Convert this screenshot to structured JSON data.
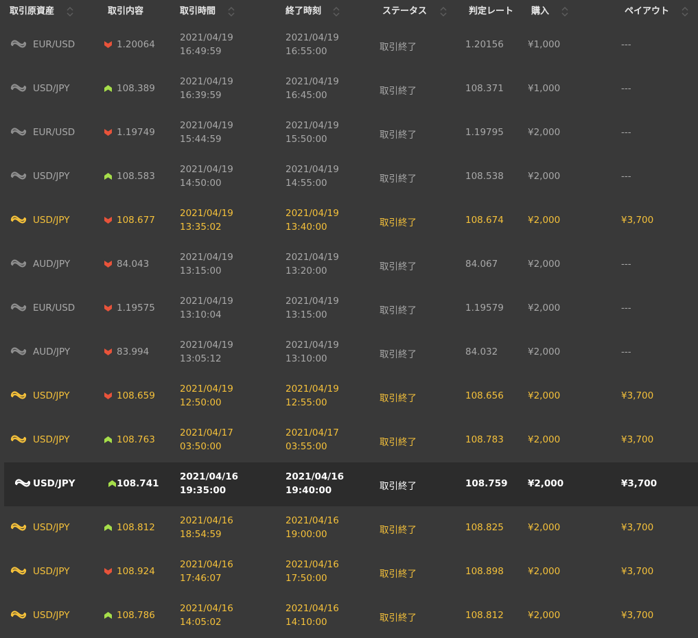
{
  "colors": {
    "background": "#393939",
    "selected_row": "#2c2c2c",
    "win_text": "#f5c13a",
    "loss_text": "#a9a9a9",
    "header_text": "#e9e9e9",
    "high_arrow": "#a6de4a",
    "low_arrow": "#e8533a"
  },
  "header": {
    "asset": "取引原資産",
    "content": "取引内容",
    "start_time": "取引時間",
    "end_time": "終了時刻",
    "status": "ステータス",
    "judge_rate": "判定レート",
    "purchase": "購入",
    "payout": "ペイアウト"
  },
  "rows": [
    {
      "asset": "EUR/USD",
      "direction": "low",
      "entry_rate": "1.20064",
      "start_date": "2021/04/19",
      "start_time": "16:49:59",
      "end_date": "2021/04/19",
      "end_time": "16:55:00",
      "status": "取引終了",
      "judge_rate": "1.20156",
      "purchase": "¥1,000",
      "payout": "---",
      "result": "loss"
    },
    {
      "asset": "USD/JPY",
      "direction": "high",
      "entry_rate": "108.389",
      "start_date": "2021/04/19",
      "start_time": "16:39:59",
      "end_date": "2021/04/19",
      "end_time": "16:45:00",
      "status": "取引終了",
      "judge_rate": "108.371",
      "purchase": "¥1,000",
      "payout": "---",
      "result": "loss"
    },
    {
      "asset": "EUR/USD",
      "direction": "low",
      "entry_rate": "1.19749",
      "start_date": "2021/04/19",
      "start_time": "15:44:59",
      "end_date": "2021/04/19",
      "end_time": "15:50:00",
      "status": "取引終了",
      "judge_rate": "1.19795",
      "purchase": "¥2,000",
      "payout": "---",
      "result": "loss"
    },
    {
      "asset": "USD/JPY",
      "direction": "high",
      "entry_rate": "108.583",
      "start_date": "2021/04/19",
      "start_time": "14:50:00",
      "end_date": "2021/04/19",
      "end_time": "14:55:00",
      "status": "取引終了",
      "judge_rate": "108.538",
      "purchase": "¥2,000",
      "payout": "---",
      "result": "loss"
    },
    {
      "asset": "USD/JPY",
      "direction": "low",
      "entry_rate": "108.677",
      "start_date": "2021/04/19",
      "start_time": "13:35:02",
      "end_date": "2021/04/19",
      "end_time": "13:40:00",
      "status": "取引終了",
      "judge_rate": "108.674",
      "purchase": "¥2,000",
      "payout": "¥3,700",
      "result": "win"
    },
    {
      "asset": "AUD/JPY",
      "direction": "low",
      "entry_rate": "84.043",
      "start_date": "2021/04/19",
      "start_time": "13:15:00",
      "end_date": "2021/04/19",
      "end_time": "13:20:00",
      "status": "取引終了",
      "judge_rate": "84.067",
      "purchase": "¥2,000",
      "payout": "---",
      "result": "loss"
    },
    {
      "asset": "EUR/USD",
      "direction": "low",
      "entry_rate": "1.19575",
      "start_date": "2021/04/19",
      "start_time": "13:10:04",
      "end_date": "2021/04/19",
      "end_time": "13:15:00",
      "status": "取引終了",
      "judge_rate": "1.19579",
      "purchase": "¥2,000",
      "payout": "---",
      "result": "loss"
    },
    {
      "asset": "AUD/JPY",
      "direction": "low",
      "entry_rate": "83.994",
      "start_date": "2021/04/19",
      "start_time": "13:05:12",
      "end_date": "2021/04/19",
      "end_time": "13:10:00",
      "status": "取引終了",
      "judge_rate": "84.032",
      "purchase": "¥2,000",
      "payout": "---",
      "result": "loss"
    },
    {
      "asset": "USD/JPY",
      "direction": "low",
      "entry_rate": "108.659",
      "start_date": "2021/04/19",
      "start_time": "12:50:00",
      "end_date": "2021/04/19",
      "end_time": "12:55:00",
      "status": "取引終了",
      "judge_rate": "108.656",
      "purchase": "¥2,000",
      "payout": "¥3,700",
      "result": "win"
    },
    {
      "asset": "USD/JPY",
      "direction": "high",
      "entry_rate": "108.763",
      "start_date": "2021/04/17",
      "start_time": "03:50:00",
      "end_date": "2021/04/17",
      "end_time": "03:55:00",
      "status": "取引終了",
      "judge_rate": "108.783",
      "purchase": "¥2,000",
      "payout": "¥3,700",
      "result": "win"
    },
    {
      "asset": "USD/JPY",
      "direction": "high",
      "entry_rate": "108.741",
      "start_date": "2021/04/16",
      "start_time": "19:35:00",
      "end_date": "2021/04/16",
      "end_time": "19:40:00",
      "status": "取引終了",
      "judge_rate": "108.759",
      "purchase": "¥2,000",
      "payout": "¥3,700",
      "result": "selected"
    },
    {
      "asset": "USD/JPY",
      "direction": "high",
      "entry_rate": "108.812",
      "start_date": "2021/04/16",
      "start_time": "18:54:59",
      "end_date": "2021/04/16",
      "end_time": "19:00:00",
      "status": "取引終了",
      "judge_rate": "108.825",
      "purchase": "¥2,000",
      "payout": "¥3,700",
      "result": "win"
    },
    {
      "asset": "USD/JPY",
      "direction": "low",
      "entry_rate": "108.924",
      "start_date": "2021/04/16",
      "start_time": "17:46:07",
      "end_date": "2021/04/16",
      "end_time": "17:50:00",
      "status": "取引終了",
      "judge_rate": "108.898",
      "purchase": "¥2,000",
      "payout": "¥3,700",
      "result": "win"
    },
    {
      "asset": "USD/JPY",
      "direction": "high",
      "entry_rate": "108.786",
      "start_date": "2021/04/16",
      "start_time": "14:05:02",
      "end_date": "2021/04/16",
      "end_time": "14:10:00",
      "status": "取引終了",
      "judge_rate": "108.812",
      "purchase": "¥2,000",
      "payout": "¥3,700",
      "result": "win"
    }
  ]
}
